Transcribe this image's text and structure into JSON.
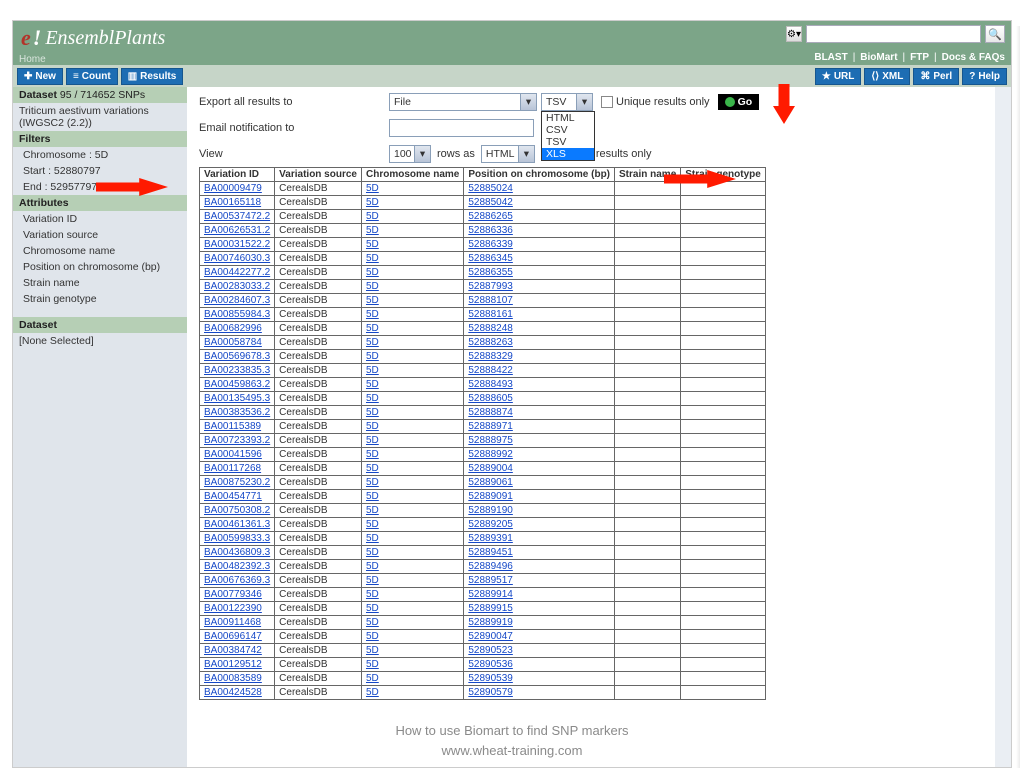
{
  "brand": {
    "name": "EnsemblPlants",
    "home": "Home"
  },
  "top_links": [
    "BLAST",
    "BioMart",
    "FTP",
    "Docs & FAQs"
  ],
  "toolbar": {
    "left": [
      {
        "icon": "✚",
        "label": "New"
      },
      {
        "icon": "≡",
        "label": "Count"
      },
      {
        "icon": "▥",
        "label": "Results"
      }
    ],
    "right": [
      {
        "icon": "★",
        "label": "URL"
      },
      {
        "icon": "⟨⟩",
        "label": "XML"
      },
      {
        "icon": "⌘",
        "label": "Perl"
      },
      {
        "icon": "?",
        "label": "Help"
      }
    ]
  },
  "sidebar": {
    "dataset_head": "Dataset",
    "dataset_count": "95 / 714652 SNPs",
    "dataset_name": "Triticum aestivum variations (IWGSC2 (2.2))",
    "filters_head": "Filters",
    "filters": [
      "Chromosome : 5D",
      "Start : 52880797",
      "End : 52957797"
    ],
    "attr_head": "Attributes",
    "attrs": [
      "Variation ID",
      "Variation source",
      "Chromosome name",
      "Position on chromosome (bp)",
      "Strain name",
      "Strain genotype"
    ],
    "dataset2_head": "Dataset",
    "dataset2_val": "[None Selected]"
  },
  "controls": {
    "export_label": "Export  all results to",
    "file_select": "File",
    "fmt_select": "TSV",
    "fmt_options": [
      "HTML",
      "CSV",
      "TSV",
      "XLS"
    ],
    "unique1": "Unique results only",
    "go": "Go",
    "email_label": "Email notification to",
    "view_label": "View",
    "rows_select": "100",
    "rows_as": "rows as",
    "page_fmt": "HTML",
    "unique2": "Unique results only"
  },
  "columns": [
    "Variation ID",
    "Variation source",
    "Chromosome name",
    "Position on chromosome (bp)",
    "Strain name",
    "Strain genotype"
  ],
  "rows": [
    {
      "id": "BA00009479",
      "src": "CerealsDB",
      "chr": "5D",
      "pos": "52885024"
    },
    {
      "id": "BA00165118",
      "src": "CerealsDB",
      "chr": "5D",
      "pos": "52885042"
    },
    {
      "id": "BA00537472.2",
      "src": "CerealsDB",
      "chr": "5D",
      "pos": "52886265"
    },
    {
      "id": "BA00626531.2",
      "src": "CerealsDB",
      "chr": "5D",
      "pos": "52886336"
    },
    {
      "id": "BA00031522.2",
      "src": "CerealsDB",
      "chr": "5D",
      "pos": "52886339"
    },
    {
      "id": "BA00746030.3",
      "src": "CerealsDB",
      "chr": "5D",
      "pos": "52886345"
    },
    {
      "id": "BA00442277.2",
      "src": "CerealsDB",
      "chr": "5D",
      "pos": "52886355"
    },
    {
      "id": "BA00283033.2",
      "src": "CerealsDB",
      "chr": "5D",
      "pos": "52887993"
    },
    {
      "id": "BA00284607.3",
      "src": "CerealsDB",
      "chr": "5D",
      "pos": "52888107"
    },
    {
      "id": "BA00855984.3",
      "src": "CerealsDB",
      "chr": "5D",
      "pos": "52888161"
    },
    {
      "id": "BA00682996",
      "src": "CerealsDB",
      "chr": "5D",
      "pos": "52888248"
    },
    {
      "id": "BA00058784",
      "src": "CerealsDB",
      "chr": "5D",
      "pos": "52888263"
    },
    {
      "id": "BA00569678.3",
      "src": "CerealsDB",
      "chr": "5D",
      "pos": "52888329"
    },
    {
      "id": "BA00233835.3",
      "src": "CerealsDB",
      "chr": "5D",
      "pos": "52888422"
    },
    {
      "id": "BA00459863.2",
      "src": "CerealsDB",
      "chr": "5D",
      "pos": "52888493"
    },
    {
      "id": "BA00135495.3",
      "src": "CerealsDB",
      "chr": "5D",
      "pos": "52888605"
    },
    {
      "id": "BA00383536.2",
      "src": "CerealsDB",
      "chr": "5D",
      "pos": "52888874"
    },
    {
      "id": "BA00115389",
      "src": "CerealsDB",
      "chr": "5D",
      "pos": "52888971"
    },
    {
      "id": "BA00723393.2",
      "src": "CerealsDB",
      "chr": "5D",
      "pos": "52888975"
    },
    {
      "id": "BA00041596",
      "src": "CerealsDB",
      "chr": "5D",
      "pos": "52888992"
    },
    {
      "id": "BA00117268",
      "src": "CerealsDB",
      "chr": "5D",
      "pos": "52889004"
    },
    {
      "id": "BA00875230.2",
      "src": "CerealsDB",
      "chr": "5D",
      "pos": "52889061"
    },
    {
      "id": "BA00454771",
      "src": "CerealsDB",
      "chr": "5D",
      "pos": "52889091"
    },
    {
      "id": "BA00750308.2",
      "src": "CerealsDB",
      "chr": "5D",
      "pos": "52889190"
    },
    {
      "id": "BA00461361.3",
      "src": "CerealsDB",
      "chr": "5D",
      "pos": "52889205"
    },
    {
      "id": "BA00599833.3",
      "src": "CerealsDB",
      "chr": "5D",
      "pos": "52889391"
    },
    {
      "id": "BA00436809.3",
      "src": "CerealsDB",
      "chr": "5D",
      "pos": "52889451"
    },
    {
      "id": "BA00482392.3",
      "src": "CerealsDB",
      "chr": "5D",
      "pos": "52889496"
    },
    {
      "id": "BA00676369.3",
      "src": "CerealsDB",
      "chr": "5D",
      "pos": "52889517"
    },
    {
      "id": "BA00779346",
      "src": "CerealsDB",
      "chr": "5D",
      "pos": "52889914"
    },
    {
      "id": "BA00122390",
      "src": "CerealsDB",
      "chr": "5D",
      "pos": "52889915"
    },
    {
      "id": "BA00911468",
      "src": "CerealsDB",
      "chr": "5D",
      "pos": "52889919"
    },
    {
      "id": "BA00696147",
      "src": "CerealsDB",
      "chr": "5D",
      "pos": "52890047"
    },
    {
      "id": "BA00384742",
      "src": "CerealsDB",
      "chr": "5D",
      "pos": "52890523"
    },
    {
      "id": "BA00129512",
      "src": "CerealsDB",
      "chr": "5D",
      "pos": "52890536"
    },
    {
      "id": "BA00083589",
      "src": "CerealsDB",
      "chr": "5D",
      "pos": "52890539"
    },
    {
      "id": "BA00424528",
      "src": "CerealsDB",
      "chr": "5D",
      "pos": "52890579"
    }
  ],
  "footer": {
    "line1": "How to use Biomart to find SNP markers",
    "line2": "www.wheat-training.com"
  }
}
